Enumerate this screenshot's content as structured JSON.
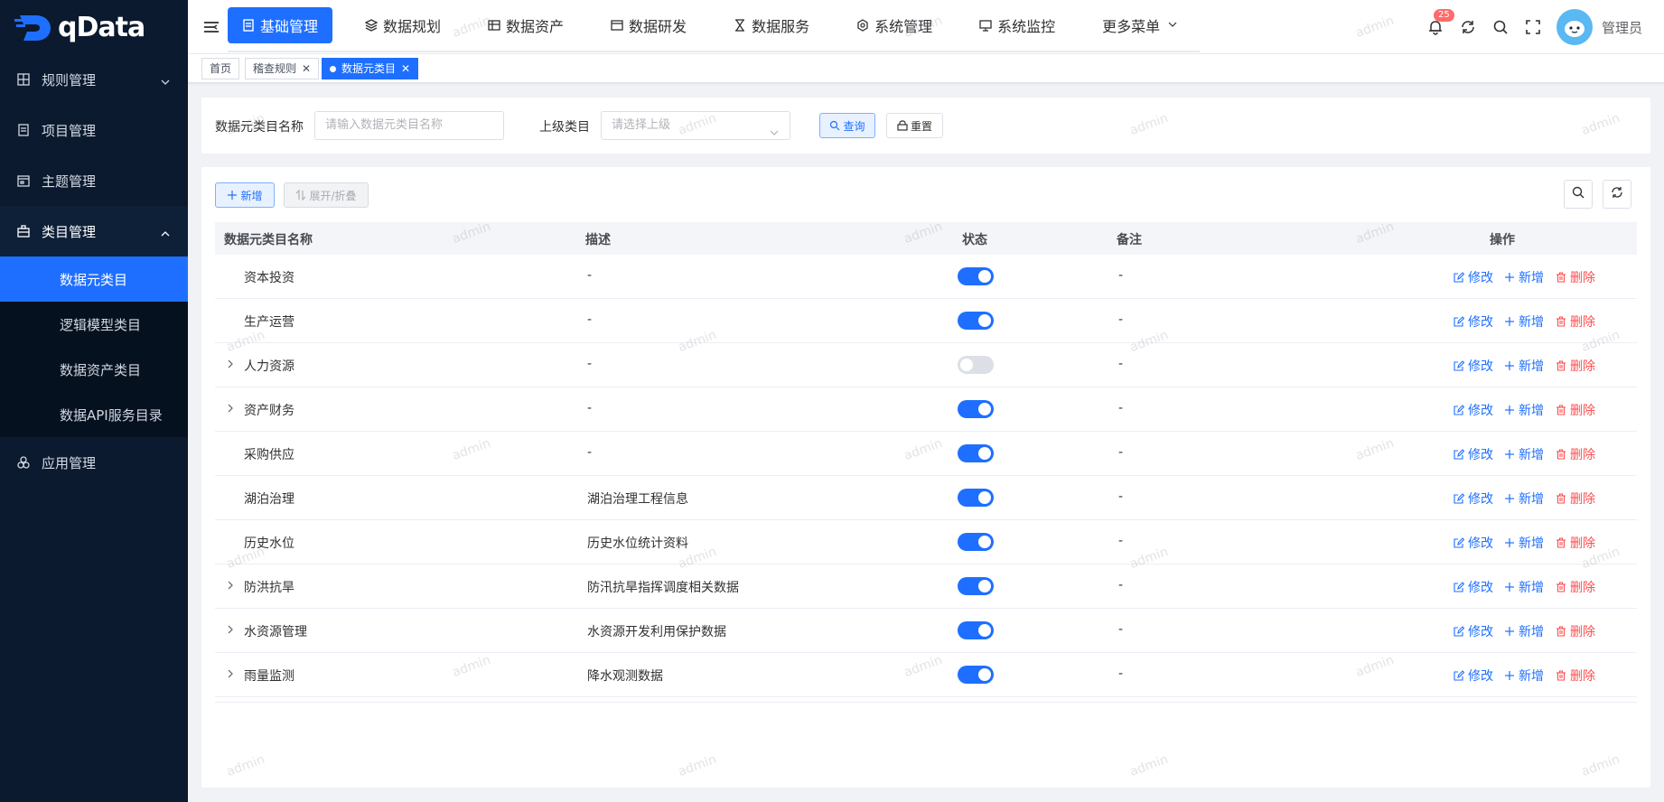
{
  "app": {
    "logo_text": "qData"
  },
  "sidebar": {
    "items": [
      {
        "label": "规则管理",
        "icon": "grid-icon",
        "expanded": false
      },
      {
        "label": "项目管理",
        "icon": "document-icon"
      },
      {
        "label": "主题管理",
        "icon": "calendar-icon"
      },
      {
        "label": "类目管理",
        "icon": "briefcase-icon",
        "expanded": true
      },
      {
        "label": "应用管理",
        "icon": "apps-icon"
      }
    ],
    "sub_items": [
      {
        "label": "数据元类目",
        "active": true
      },
      {
        "label": "逻辑模型类目"
      },
      {
        "label": "数据资产类目"
      },
      {
        "label": "数据API服务目录"
      }
    ]
  },
  "topnav": {
    "items": [
      {
        "label": "基础管理",
        "icon": "document-icon",
        "active": true
      },
      {
        "label": "数据规划",
        "icon": "layers-icon"
      },
      {
        "label": "数据资产",
        "icon": "database-icon"
      },
      {
        "label": "数据研发",
        "icon": "window-icon"
      },
      {
        "label": "数据服务",
        "icon": "hourglass-icon"
      },
      {
        "label": "系统管理",
        "icon": "settings-icon"
      },
      {
        "label": "系统监控",
        "icon": "monitor-icon"
      },
      {
        "label": "更多菜单",
        "icon": "chevron-down-icon"
      }
    ],
    "notification_count": "25",
    "username": "管理员"
  },
  "tags": [
    {
      "label": "首页"
    },
    {
      "label": "稽查规则",
      "closable": true
    },
    {
      "label": "数据元类目",
      "closable": true,
      "active": true
    }
  ],
  "search": {
    "name_label": "数据元类目名称",
    "name_placeholder": "请输入数据元类目名称",
    "parent_label": "上级类目",
    "parent_placeholder": "请选择上级",
    "query_label": "查询",
    "reset_label": "重置"
  },
  "toolbar": {
    "add_label": "新增",
    "expand_label": "展开/折叠"
  },
  "table": {
    "columns": [
      "数据元类目名称",
      "描述",
      "状态",
      "备注",
      "操作"
    ],
    "actions": {
      "edit": "修改",
      "add": "新增",
      "delete": "删除"
    },
    "rows": [
      {
        "name": "资本投资",
        "desc": "-",
        "enabled": true,
        "remark": "-",
        "expandable": false
      },
      {
        "name": "生产运营",
        "desc": "-",
        "enabled": true,
        "remark": "-",
        "expandable": false
      },
      {
        "name": "人力资源",
        "desc": "-",
        "enabled": false,
        "remark": "-",
        "expandable": true
      },
      {
        "name": "资产财务",
        "desc": "-",
        "enabled": true,
        "remark": "-",
        "expandable": true
      },
      {
        "name": "采购供应",
        "desc": "-",
        "enabled": true,
        "remark": "-",
        "expandable": false
      },
      {
        "name": "湖泊治理",
        "desc": "湖泊治理工程信息",
        "enabled": true,
        "remark": "-",
        "expandable": false
      },
      {
        "name": "历史水位",
        "desc": "历史水位统计资料",
        "enabled": true,
        "remark": "-",
        "expandable": false
      },
      {
        "name": "防洪抗旱",
        "desc": "防汛抗旱指挥调度相关数据",
        "enabled": true,
        "remark": "-",
        "expandable": true
      },
      {
        "name": "水资源管理",
        "desc": "水资源开发利用保护数据",
        "enabled": true,
        "remark": "-",
        "expandable": true
      },
      {
        "name": "雨量监测",
        "desc": "降水观测数据",
        "enabled": true,
        "remark": "-",
        "expandable": true
      }
    ]
  },
  "watermark": "admin",
  "colors": {
    "primary": "#1e6fff",
    "danger": "#ff4d4f",
    "sidebar_bg": "#0b1a2e"
  }
}
